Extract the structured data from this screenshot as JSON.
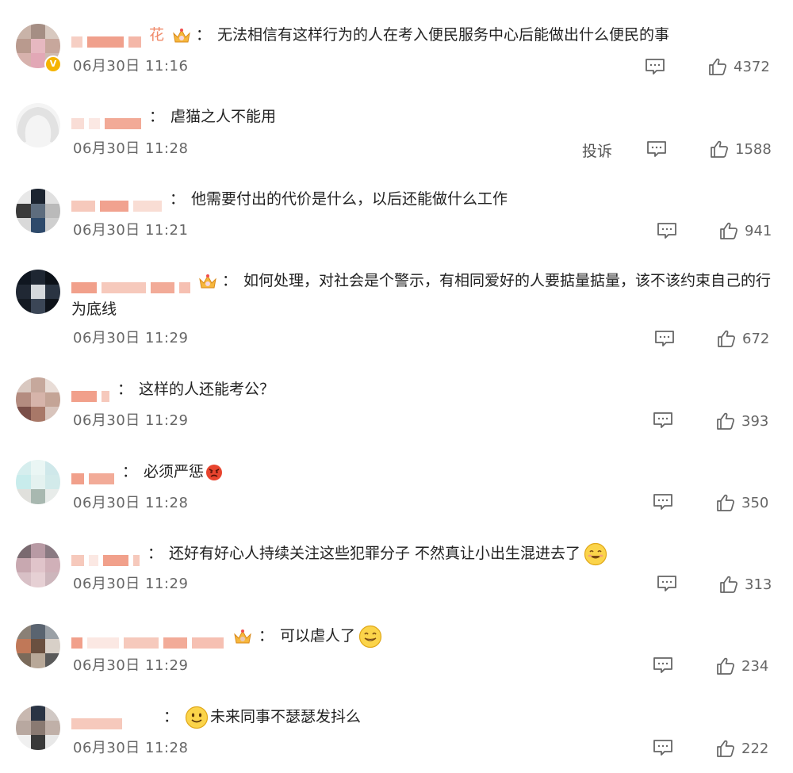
{
  "actions": {
    "report_label": "投诉"
  },
  "icons": {
    "reply": "comment-icon",
    "like": "thumbs-up-icon",
    "verified": "verified-badge-icon",
    "crown": "crown-icon"
  },
  "comments": [
    {
      "text": "无法相信有这样行为的人在考入便民服务中心后能做出什么便民的事",
      "time": "06月30日 11:16",
      "likes": "4372",
      "name_tail": "花"
    },
    {
      "text": "虐猫之人不能用",
      "time": "06月30日 11:28",
      "likes": "1588"
    },
    {
      "text": "他需要付出的代价是什么，以后还能做什么工作",
      "time": "06月30日 11:21",
      "likes": "941"
    },
    {
      "text": "如何处理，对社会是个警示，有相同爱好的人要掂量掂量，该不该约束自己的行为底线",
      "time": "06月30日 11:29",
      "likes": "672"
    },
    {
      "text": "这样的人还能考公？",
      "time": "06月30日 11:29",
      "likes": "393"
    },
    {
      "text": "必须严惩",
      "time": "06月30日 11:28",
      "likes": "350"
    },
    {
      "text": "还好有好心人持续关注这些犯罪分子 不然真让小出生混进去了",
      "time": "06月30日 11:29",
      "likes": "313"
    },
    {
      "text": "可以虐人了",
      "time": "06月30日 11:29",
      "likes": "234"
    },
    {
      "text": "未来同事不瑟瑟发抖么",
      "time": "06月30日 11:28",
      "likes": "222"
    }
  ]
}
